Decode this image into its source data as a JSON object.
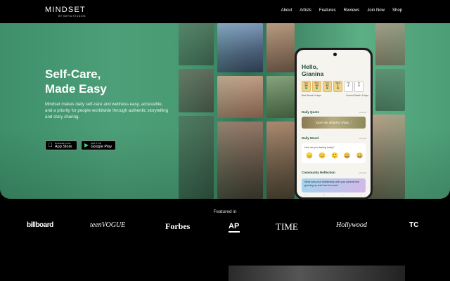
{
  "brand": {
    "name": "MINDSET",
    "sub": "BY SOFIA STUDIOS"
  },
  "nav": {
    "links": [
      "About",
      "Artists",
      "Features",
      "Reviews",
      "Join Now",
      "Shop"
    ]
  },
  "hero": {
    "title_line1": "Self-Care,",
    "title_line2": "Made Easy",
    "description": "Mindset makes daily self-care and wellness easy, accessible, and a priority for people worldwide through authentic storytelling and story sharing.",
    "app_store": {
      "small": "Download on the",
      "big": "App Store"
    },
    "google_play": {
      "small": "GET IT ON",
      "big": "Google Play"
    }
  },
  "phone": {
    "greeting_line1": "Hello,",
    "greeting_line2": "Gianina",
    "week": [
      {
        "d": "Sun",
        "n": "26",
        "on": true
      },
      {
        "d": "Mon",
        "n": "30",
        "on": true
      },
      {
        "d": "Tue",
        "n": "31",
        "on": true
      },
      {
        "d": "Wed",
        "n": "1",
        "on": true
      },
      {
        "d": "Thu",
        "n": "2",
        "on": false
      },
      {
        "d": "Fri",
        "n": "3",
        "on": false
      }
    ],
    "best_streak": "Best Streak: 5 days",
    "current_streak": "Current Streak: 5 days",
    "daily_quote": "Daily Quote",
    "quote_text": "\"Don't be afraid to show...\"",
    "daily_mood": "Daily Mood",
    "mood_question": "How are you feeling today?",
    "moods": [
      "😞",
      "😐",
      "🙂",
      "😀",
      "😄"
    ],
    "community": "Community Reflection",
    "reflection": "What was your relationship with your parents like growing up and how is it now?",
    "view_all": "View All"
  },
  "featured": {
    "label": "Featured in",
    "logos": [
      "billboard",
      "teenVOGUE",
      "Forbes",
      "AP",
      "TIME",
      "Hollywood",
      "TC"
    ]
  },
  "colors": {
    "hero_green": "#4c9f78",
    "phone_header": "#1f4e3d"
  }
}
